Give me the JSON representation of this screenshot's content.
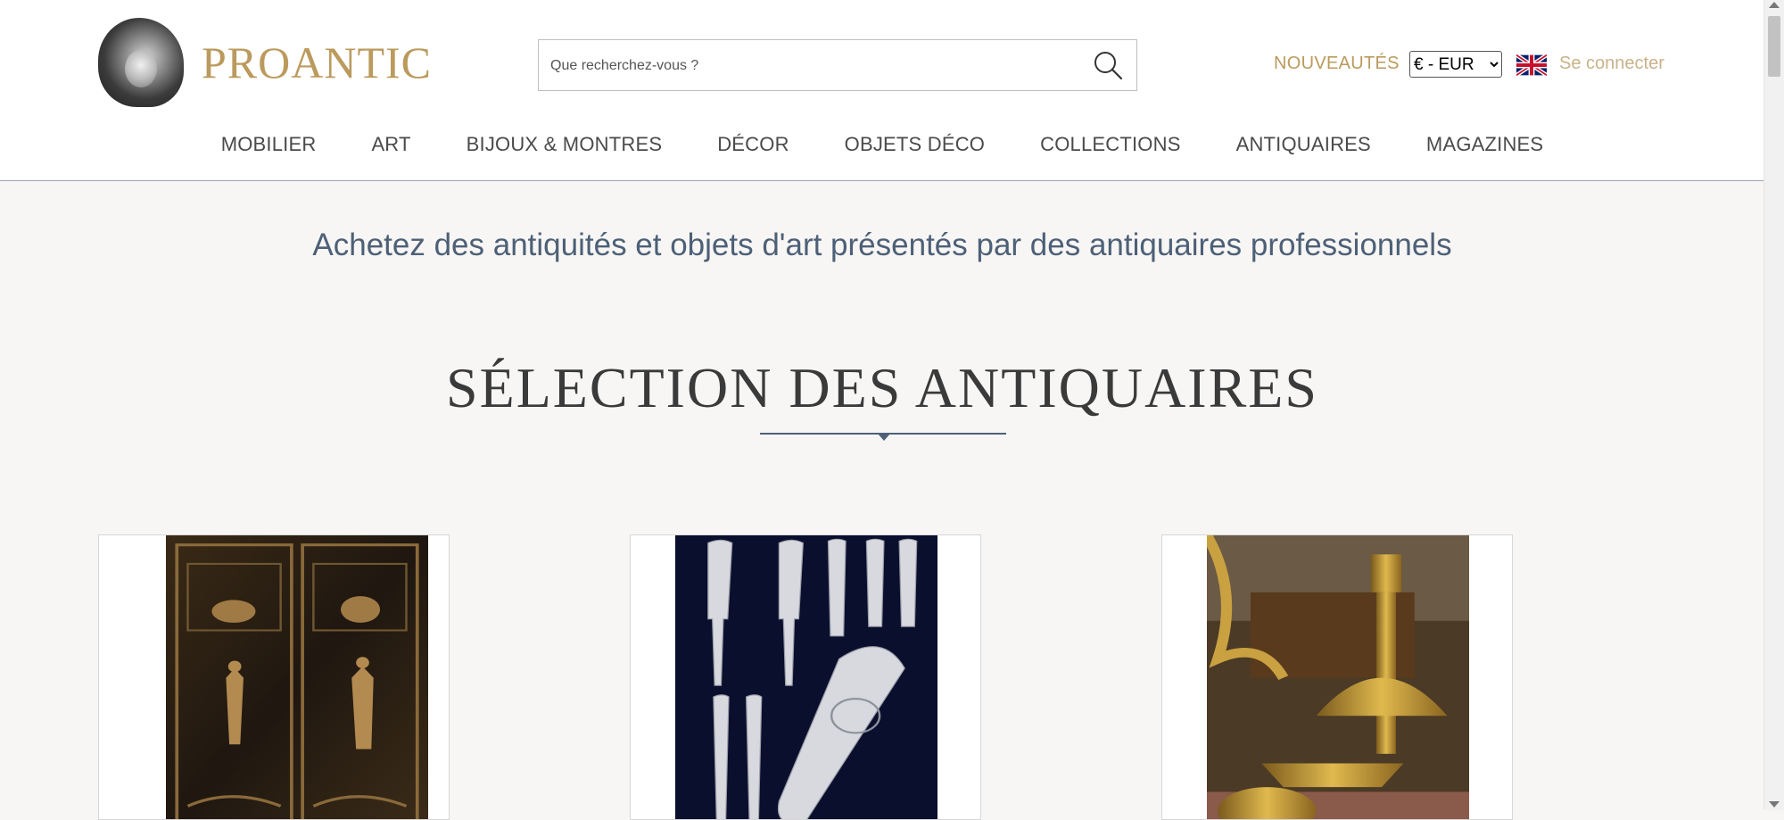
{
  "brand": {
    "name": "PROANTIC",
    "color": "#bb9a5d"
  },
  "search": {
    "placeholder": "Que recherchez-vous ?",
    "value": ""
  },
  "header": {
    "new_label": "NOUVEAUTÉS",
    "currency": {
      "selected": "€ - EUR",
      "options": [
        "€ - EUR"
      ]
    },
    "language_icon": "uk-flag-icon",
    "login_label": "Se connecter"
  },
  "nav": {
    "items": [
      {
        "label": "MOBILIER"
      },
      {
        "label": "ART"
      },
      {
        "label": "BIJOUX & MONTRES"
      },
      {
        "label": "DÉCOR"
      },
      {
        "label": "OBJETS DÉCO"
      },
      {
        "label": "COLLECTIONS"
      },
      {
        "label": "ANTIQUAIRES"
      },
      {
        "label": "MAGAZINES"
      }
    ]
  },
  "main": {
    "tagline": "Achetez des antiquités et objets d'art présentés par des antiquaires professionnels",
    "section_title": "SÉLECTION DES ANTIQUAIRES"
  },
  "products": [
    {
      "image": "painted-cabinet-image"
    },
    {
      "image": "silver-cutlery-image"
    },
    {
      "image": "gilt-bronze-candlestick-image"
    }
  ]
}
